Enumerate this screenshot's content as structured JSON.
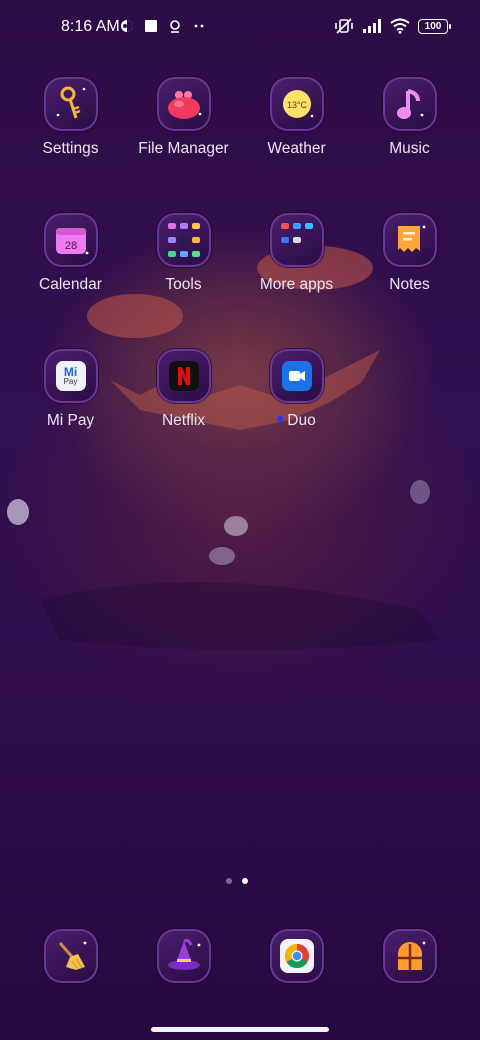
{
  "status_bar": {
    "time": "8:16 AM",
    "battery": "100",
    "icons_left": [
      "vpn-icon",
      "square-notification-icon",
      "location-icon",
      "more-icon"
    ],
    "icons_right": [
      "muted-vibrate-icon",
      "signal-icon",
      "wifi-icon",
      "battery-icon"
    ]
  },
  "apps": [
    {
      "label": "Settings",
      "icon": "key-icon"
    },
    {
      "label": "File Manager",
      "icon": "purse-icon"
    },
    {
      "label": "Weather",
      "icon": "moon-weather-icon",
      "temp": "13°C"
    },
    {
      "label": "Music",
      "icon": "music-note-icon"
    },
    {
      "label": "Calendar",
      "icon": "calendar-icon",
      "date": "28"
    },
    {
      "label": "Tools",
      "icon": "folder-icon"
    },
    {
      "label": "More apps",
      "icon": "folder-icon"
    },
    {
      "label": "Notes",
      "icon": "notes-icon"
    },
    {
      "label": "Mi Pay",
      "icon": "mipay-icon",
      "logo_top": "Mi",
      "logo_bottom": "Pay"
    },
    {
      "label": "Netflix",
      "icon": "netflix-icon"
    },
    {
      "label": "Duo",
      "icon": "duo-icon"
    }
  ],
  "page_indicator": {
    "pages": 2,
    "active": 2
  },
  "dock": [
    {
      "icon": "broom-icon"
    },
    {
      "icon": "witch-hat-icon"
    },
    {
      "icon": "chrome-icon"
    },
    {
      "icon": "window-icon"
    }
  ],
  "colors": {
    "background": "#2f0c4a",
    "tile_border": "#6a3796",
    "notification_dot": "#2b35ff"
  }
}
